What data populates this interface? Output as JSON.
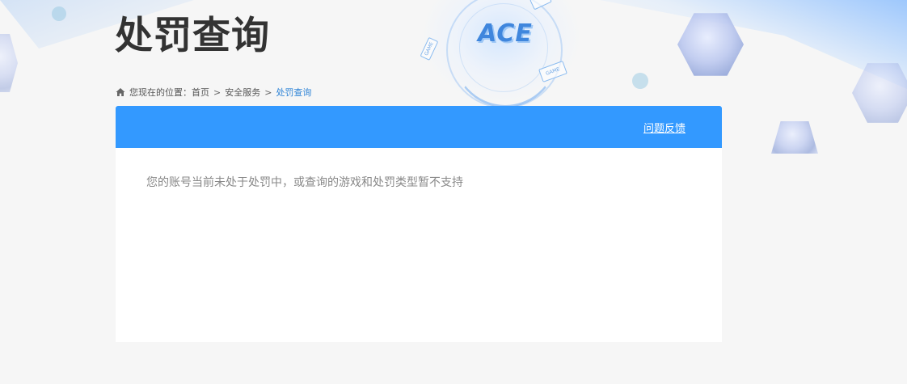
{
  "page": {
    "title": "处罚查询"
  },
  "logo": {
    "brand": "ACE",
    "tags": [
      "GAME",
      "GAME"
    ]
  },
  "breadcrumb": {
    "icon": "home-icon",
    "prefix": "您现在的位置：",
    "items": [
      "首页",
      "安全服务",
      "处罚查询"
    ],
    "separator": ">"
  },
  "panel": {
    "header_color": "#3399ff",
    "feedback_label": "问题反馈",
    "message": "您的账号当前未处于处罚中，或查询的游戏和处罚类型暂不支持"
  },
  "colors": {
    "accent": "#3399ff",
    "breadcrumb_current": "#2f84d6",
    "title": "#333333",
    "message": "#888888",
    "background": "#f6f6f6"
  }
}
